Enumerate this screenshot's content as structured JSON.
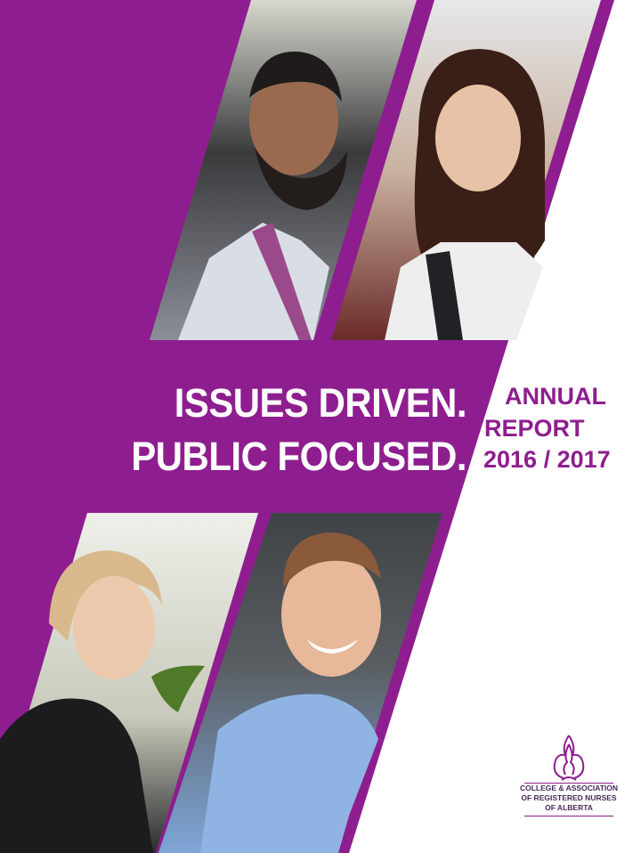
{
  "headline": {
    "line1": "ISSUES DRIVEN.",
    "line2": "PUBLIC FOCUSED."
  },
  "report": {
    "line1": "ANNUAL",
    "line2": "REPORT",
    "line3": "2016 / 2017"
  },
  "logo": {
    "line1": "COLLEGE & ASSOCIATION",
    "line2": "OF REGISTERED NURSES",
    "line3": "OF ALBERTA"
  },
  "colors": {
    "purple": "#8e1e8f",
    "white": "#ffffff"
  },
  "photos": [
    {
      "name": "photo-bearded-man-striped-shirt"
    },
    {
      "name": "photo-smiling-woman-dark-hair"
    },
    {
      "name": "photo-woman-glasses-blonde"
    },
    {
      "name": "photo-smiling-man-blue-shirt"
    }
  ]
}
